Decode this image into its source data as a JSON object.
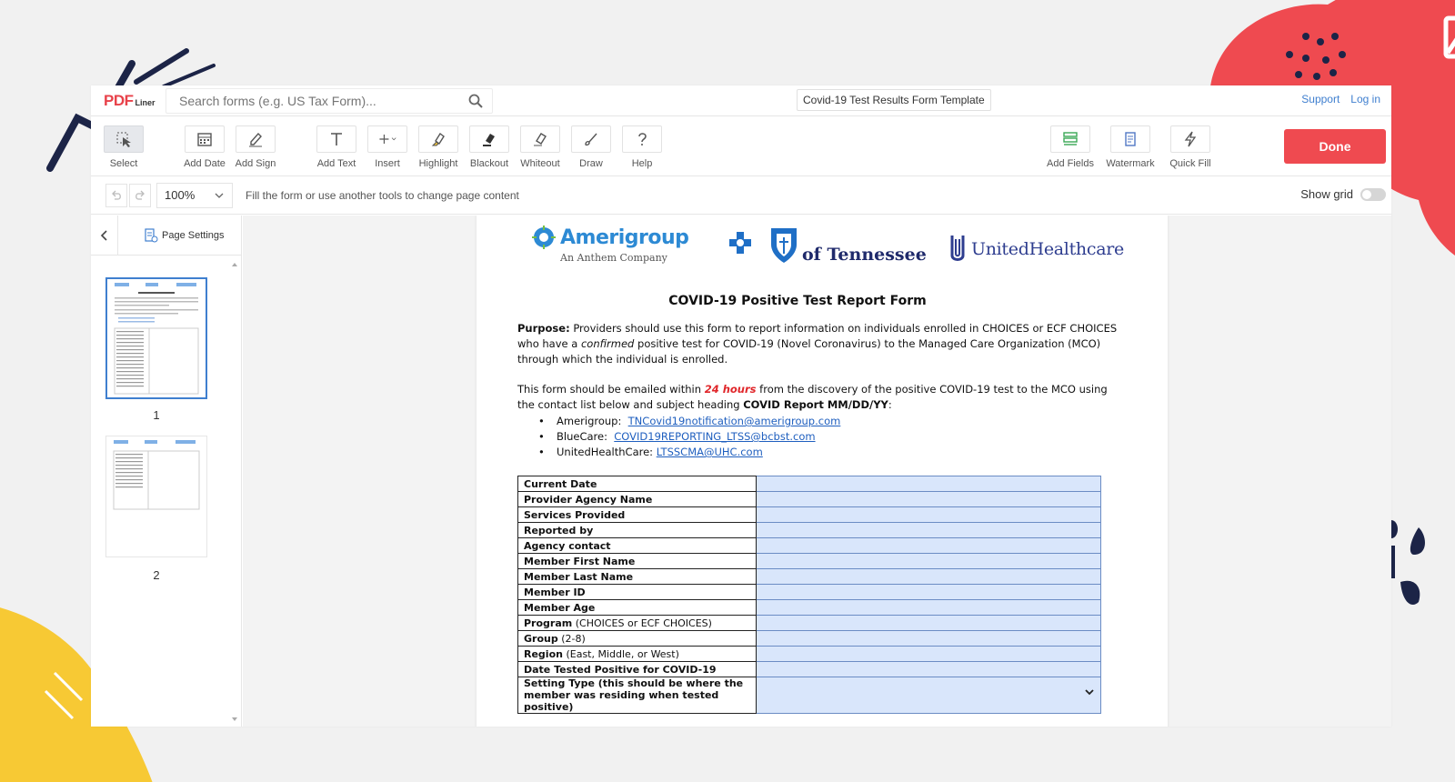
{
  "header": {
    "logo_main": "PDF",
    "logo_sub": "Liner",
    "search_placeholder": "Search forms (e.g. US Tax Form)...",
    "doc_title": "Covid-19 Test Results Form Template",
    "support_label": "Support",
    "login_label": "Log in"
  },
  "toolbar": {
    "tools": [
      {
        "label": "Select"
      },
      {
        "label": "Add Date"
      },
      {
        "label": "Add Sign"
      },
      {
        "label": "Add Text"
      },
      {
        "label": "Insert"
      },
      {
        "label": "Highlight"
      },
      {
        "label": "Blackout"
      },
      {
        "label": "Whiteout"
      },
      {
        "label": "Draw"
      },
      {
        "label": "Help"
      }
    ],
    "right_tools": [
      {
        "label": "Add Fields"
      },
      {
        "label": "Watermark"
      },
      {
        "label": "Quick Fill"
      }
    ],
    "done_label": "Done"
  },
  "subbar": {
    "zoom": "100%",
    "hint": "Fill the form or use another tools to change page content",
    "show_grid_label": "Show grid"
  },
  "sidebar": {
    "page_settings_label": "Page Settings",
    "pages": [
      {
        "number": "1"
      },
      {
        "number": "2"
      }
    ]
  },
  "document": {
    "logos": {
      "amerigroup": "Amerigroup",
      "amerigroup_sub": "An Anthem Company",
      "bcbs": "of Tennessee",
      "uhc": "UnitedHealthcare"
    },
    "title": "COVID-19 Positive Test Report Form",
    "purpose_label": "Purpose:",
    "purpose_text_1": "Providers should use this form to report information on individuals enrolled in CHOICES or ECF CHOICES who have a",
    "purpose_italic": "confirmed",
    "purpose_text_2": "positive test for COVID-19 (Novel Coronavirus) to the Managed Care Organization (MCO) through which the individual is enrolled.",
    "email_text_1": "This form should be emailed within",
    "email_red": "24 hours",
    "email_text_2": "from the discovery of the positive COVID-19 test to the MCO using the contact list below and subject heading",
    "email_subject": "COVID Report MM/DD/YY",
    "email_colon": ":",
    "contacts": [
      {
        "org": "Amerigroup:",
        "email": "TNCovid19notification@amerigroup.com"
      },
      {
        "org": "BlueCare:",
        "email": "COVID19REPORTING_LTSS@bcbst.com"
      },
      {
        "org": "UnitedHealthCare:",
        "email": "LTSSCMA@UHC.com"
      }
    ],
    "fields": [
      {
        "bold": "Current Date",
        "rest": ""
      },
      {
        "bold": "Provider Agency Name",
        "rest": ""
      },
      {
        "bold": "Services Provided",
        "rest": ""
      },
      {
        "bold": "Reported by",
        "rest": ""
      },
      {
        "bold": "Agency contact",
        "rest": ""
      },
      {
        "bold": "Member First Name",
        "rest": ""
      },
      {
        "bold": "Member Last Name",
        "rest": ""
      },
      {
        "bold": "Member ID",
        "rest": ""
      },
      {
        "bold": "Member Age",
        "rest": ""
      },
      {
        "bold": "Program",
        "rest": " (CHOICES or ECF CHOICES)"
      },
      {
        "bold": "Group",
        "rest": " (2-8)"
      },
      {
        "bold": "Region",
        "rest": " (East, Middle, or West)"
      },
      {
        "bold": "Date Tested Positive for COVID-19",
        "rest": ""
      },
      {
        "bold": "Setting Type (this should be where the member was residing when tested positive)",
        "rest": ""
      }
    ]
  },
  "colors": {
    "accent": "#ef4a50",
    "link": "#3f7fcf",
    "field_fill": "#d9e6fb"
  }
}
